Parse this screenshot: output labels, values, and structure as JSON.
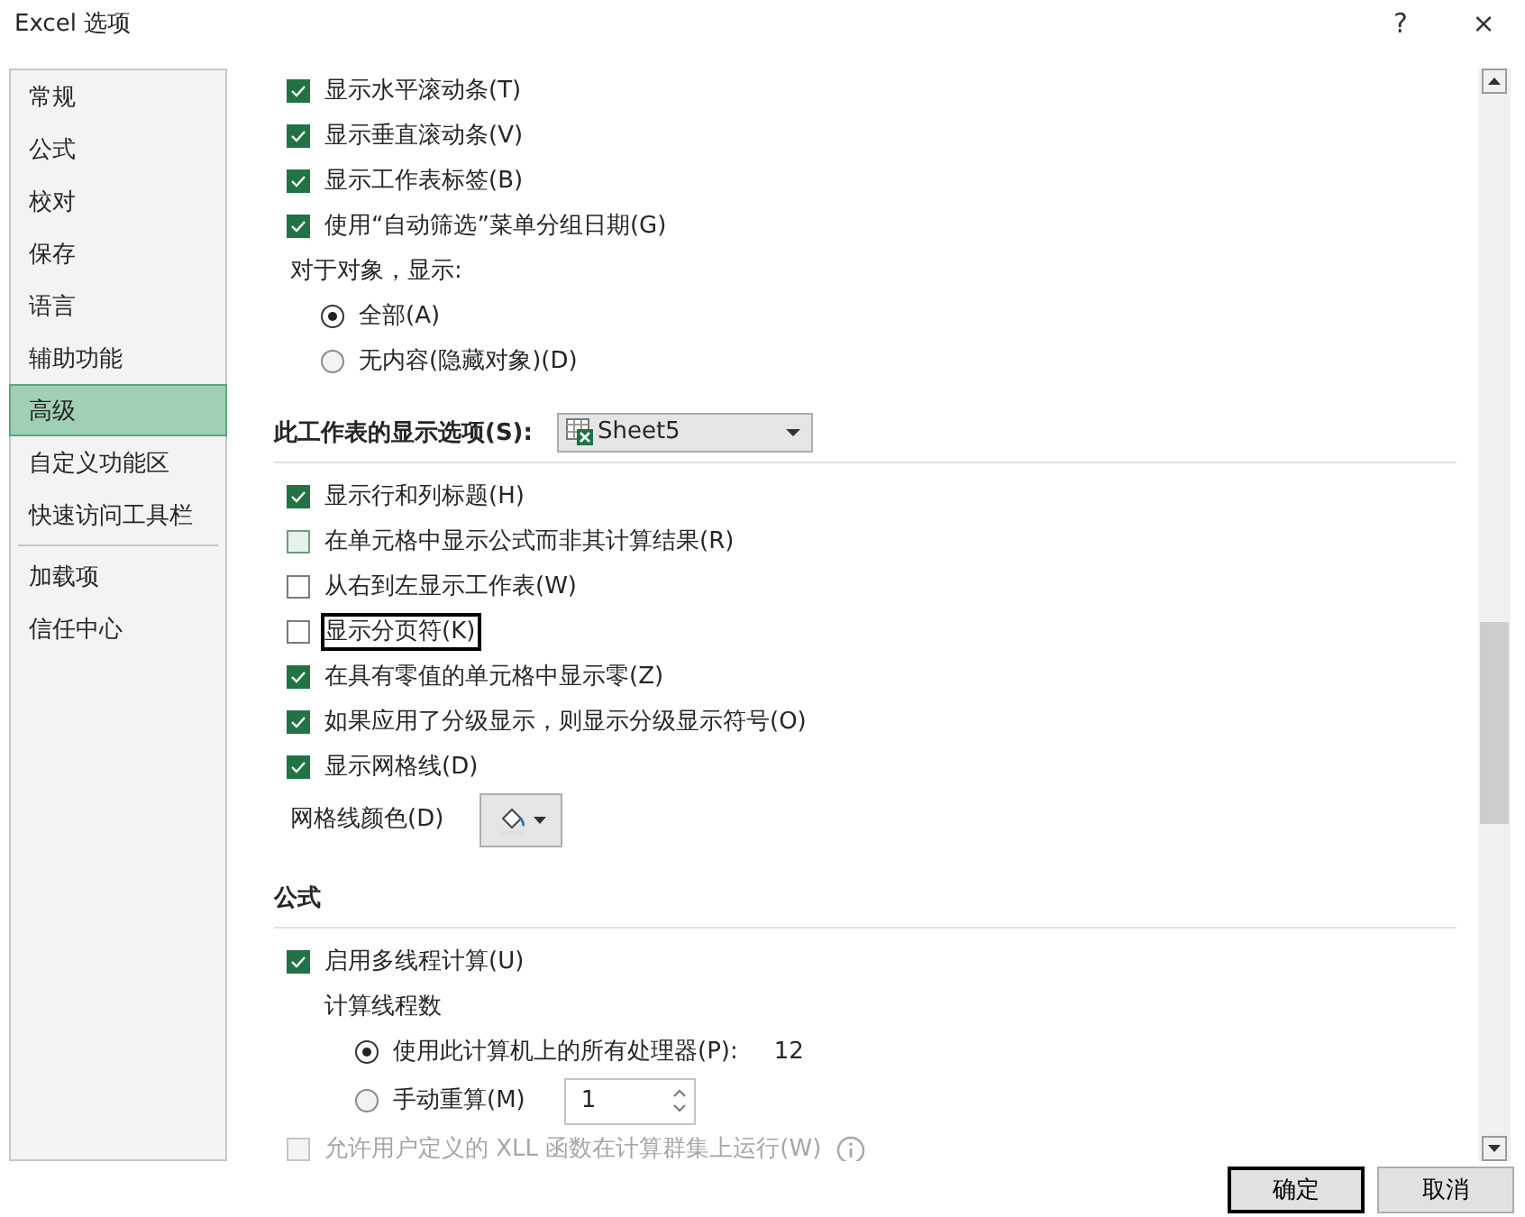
{
  "window": {
    "title": "Excel 选项",
    "help": "?",
    "close": "×"
  },
  "sidebar": {
    "groups": [
      [
        {
          "label": "常规",
          "selected": false
        },
        {
          "label": "公式",
          "selected": false
        },
        {
          "label": "校对",
          "selected": false
        },
        {
          "label": "保存",
          "selected": false
        },
        {
          "label": "语言",
          "selected": false
        },
        {
          "label": "辅助功能",
          "selected": false
        },
        {
          "label": "高级",
          "selected": true
        },
        {
          "label": "自定义功能区",
          "selected": false
        },
        {
          "label": "快速访问工具栏",
          "selected": false
        }
      ],
      [
        {
          "label": "加载项",
          "selected": false
        },
        {
          "label": "信任中心",
          "selected": false
        }
      ]
    ]
  },
  "content": [
    {
      "kind": "checkbox",
      "label": "显示水平滚动条(T)",
      "checked": true,
      "focused": false,
      "disabled": false
    },
    {
      "kind": "checkbox",
      "label": "显示垂直滚动条(V)",
      "checked": true,
      "focused": false,
      "disabled": false
    },
    {
      "kind": "checkbox",
      "label": "显示工作表标签(B)",
      "checked": true,
      "focused": false,
      "disabled": false
    },
    {
      "kind": "checkbox",
      "label": "使用“自动筛选”菜单分组日期(G)",
      "checked": true,
      "focused": false,
      "disabled": false
    },
    {
      "kind": "label",
      "label": "对于对象，显示:",
      "children": [
        {
          "kind": "radio",
          "label": "全部(A)",
          "selected": true
        },
        {
          "kind": "radio",
          "label": "无内容(隐藏对象)(D)",
          "selected": false
        }
      ]
    },
    {
      "kind": "section",
      "label": "此工作表的显示选项(S):",
      "dropdown": "Sheet5"
    },
    {
      "kind": "checkbox",
      "label": "显示行和列标题(H)",
      "checked": true,
      "focused": false,
      "disabled": false
    },
    {
      "kind": "checkbox",
      "label": "在单元格中显示公式而非其计算结果(R)",
      "checked": false,
      "hovered": true,
      "focused": false,
      "disabled": false
    },
    {
      "kind": "checkbox",
      "label": "从右到左显示工作表(W)",
      "checked": false,
      "focused": false,
      "disabled": false
    },
    {
      "kind": "checkbox",
      "label": "显示分页符(K)",
      "checked": false,
      "focused": true,
      "disabled": false
    },
    {
      "kind": "checkbox",
      "label": "在具有零值的单元格中显示零(Z)",
      "checked": true,
      "focused": false,
      "disabled": false
    },
    {
      "kind": "checkbox",
      "label": "如果应用了分级显示，则显示分级显示符号(O)",
      "checked": true,
      "focused": false,
      "disabled": false
    },
    {
      "kind": "checkbox",
      "label": "显示网格线(D)",
      "checked": true,
      "focused": false,
      "disabled": false
    },
    {
      "kind": "color",
      "label": "网格线颜色(D)"
    },
    {
      "kind": "section",
      "label": "公式"
    },
    {
      "kind": "checkbox",
      "label": "启用多线程计算(U)",
      "checked": true,
      "focused": false,
      "disabled": false,
      "children": [
        {
          "kind": "label",
          "label": "计算线程数",
          "children": [
            {
              "kind": "radio",
              "label": "使用此计算机上的所有处理器(P):",
              "selected": true,
              "value": "12"
            },
            {
              "kind": "radio",
              "label": "手动重算(M)",
              "selected": false,
              "spin": "1"
            }
          ]
        }
      ]
    },
    {
      "kind": "checkbox",
      "label": "允许用户定义的 XLL 函数在计算群集上运行(W)",
      "checked": false,
      "focused": false,
      "disabled": true,
      "info": true
    }
  ],
  "buttons": [
    {
      "label": "确定",
      "focused": true
    },
    {
      "label": "取消",
      "focused": false
    }
  ]
}
